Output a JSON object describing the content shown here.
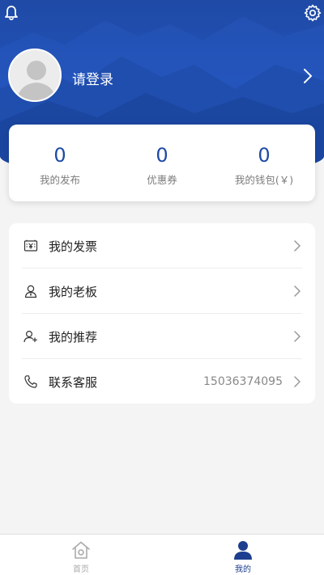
{
  "header": {
    "login_text": "请登录"
  },
  "stats": [
    {
      "value": "0",
      "label": "我的发布"
    },
    {
      "value": "0",
      "label": "优惠券"
    },
    {
      "value": "0",
      "label": "我的钱包(￥)"
    }
  ],
  "menu": [
    {
      "label": "我的发票",
      "icon": "invoice-icon",
      "value": ""
    },
    {
      "label": "我的老板",
      "icon": "boss-icon",
      "value": ""
    },
    {
      "label": "我的推荐",
      "icon": "add-user-icon",
      "value": ""
    },
    {
      "label": "联系客服",
      "icon": "phone-icon",
      "value": "15036374095"
    }
  ],
  "tabbar": {
    "home_label": "首页",
    "mine_label": "我的"
  },
  "colors": {
    "primary": "#1e4aa5",
    "tab_active": "#1e3f8f",
    "tab_inactive": "#aaaaaa"
  }
}
